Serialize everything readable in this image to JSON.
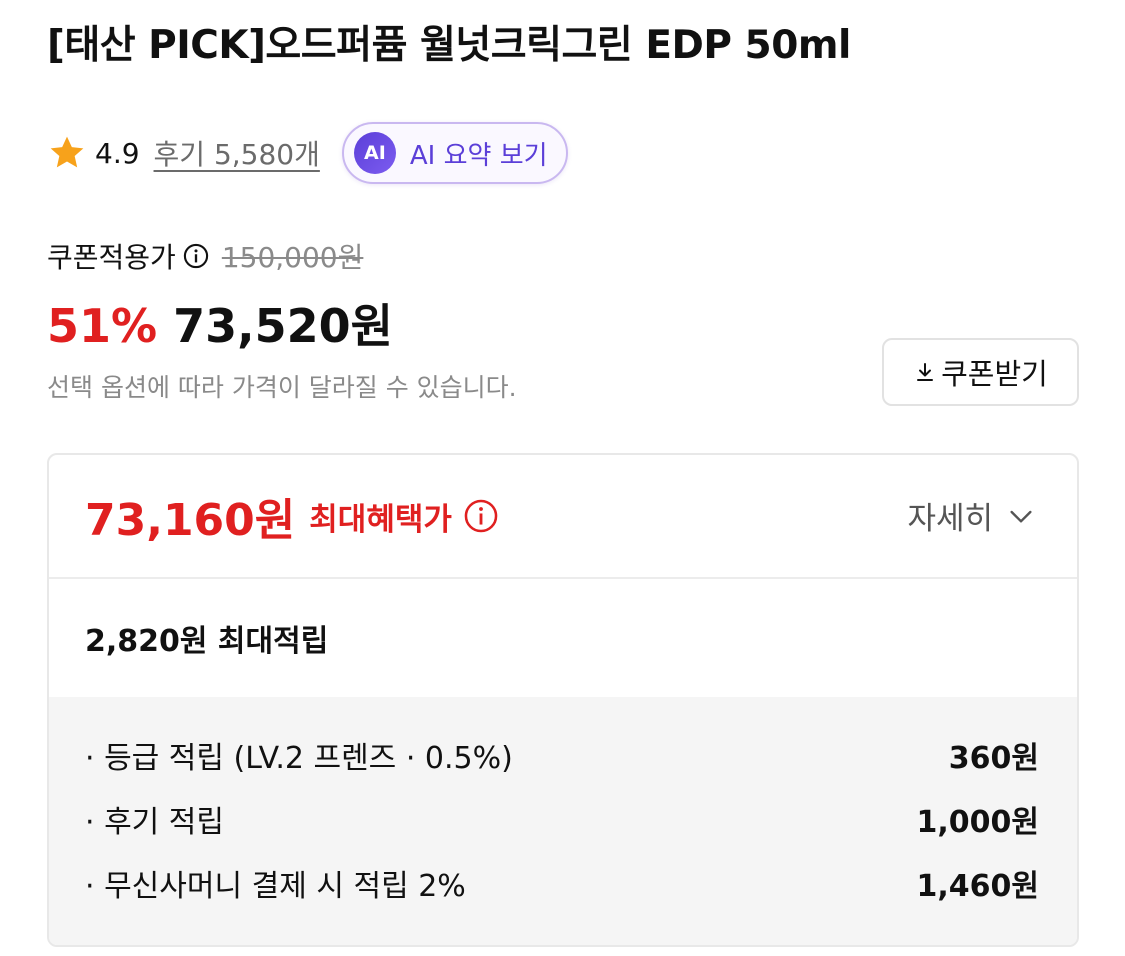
{
  "product": {
    "title": "[태산 PICK]오드퍼퓸 월넛크릭그린 EDP 50ml"
  },
  "rating": {
    "value": "4.9",
    "reviews_label": "후기 5,580개",
    "star_color": "#f7a21b"
  },
  "ai_summary": {
    "badge": "AI",
    "label": "AI 요약 보기"
  },
  "pricing": {
    "coupon_label": "쿠폰적용가",
    "original_price": "150,000원",
    "discount": "51%",
    "sale_price": "73,520원",
    "note": "선택 옵션에 따라 가격이 달라질 수 있습니다.",
    "coupon_button": "쿠폰받기",
    "accent_color": "#e02020"
  },
  "benefit": {
    "max_price": "73,160원",
    "max_label": "최대혜택가",
    "detail_label": "자세히",
    "points_total": "2,820원 최대적립",
    "items": [
      {
        "label": "· 등급 적립 (LV.2 프렌즈 · 0.5%)",
        "amount": "360원"
      },
      {
        "label": "· 후기 적립",
        "amount": "1,000원"
      },
      {
        "label": "· 무신사머니 결제 시 적립 2%",
        "amount": "1,460원"
      }
    ]
  },
  "icons": {
    "star": "star-icon",
    "info": "info-icon",
    "download": "download-icon",
    "chevron": "chevron-down-icon"
  }
}
